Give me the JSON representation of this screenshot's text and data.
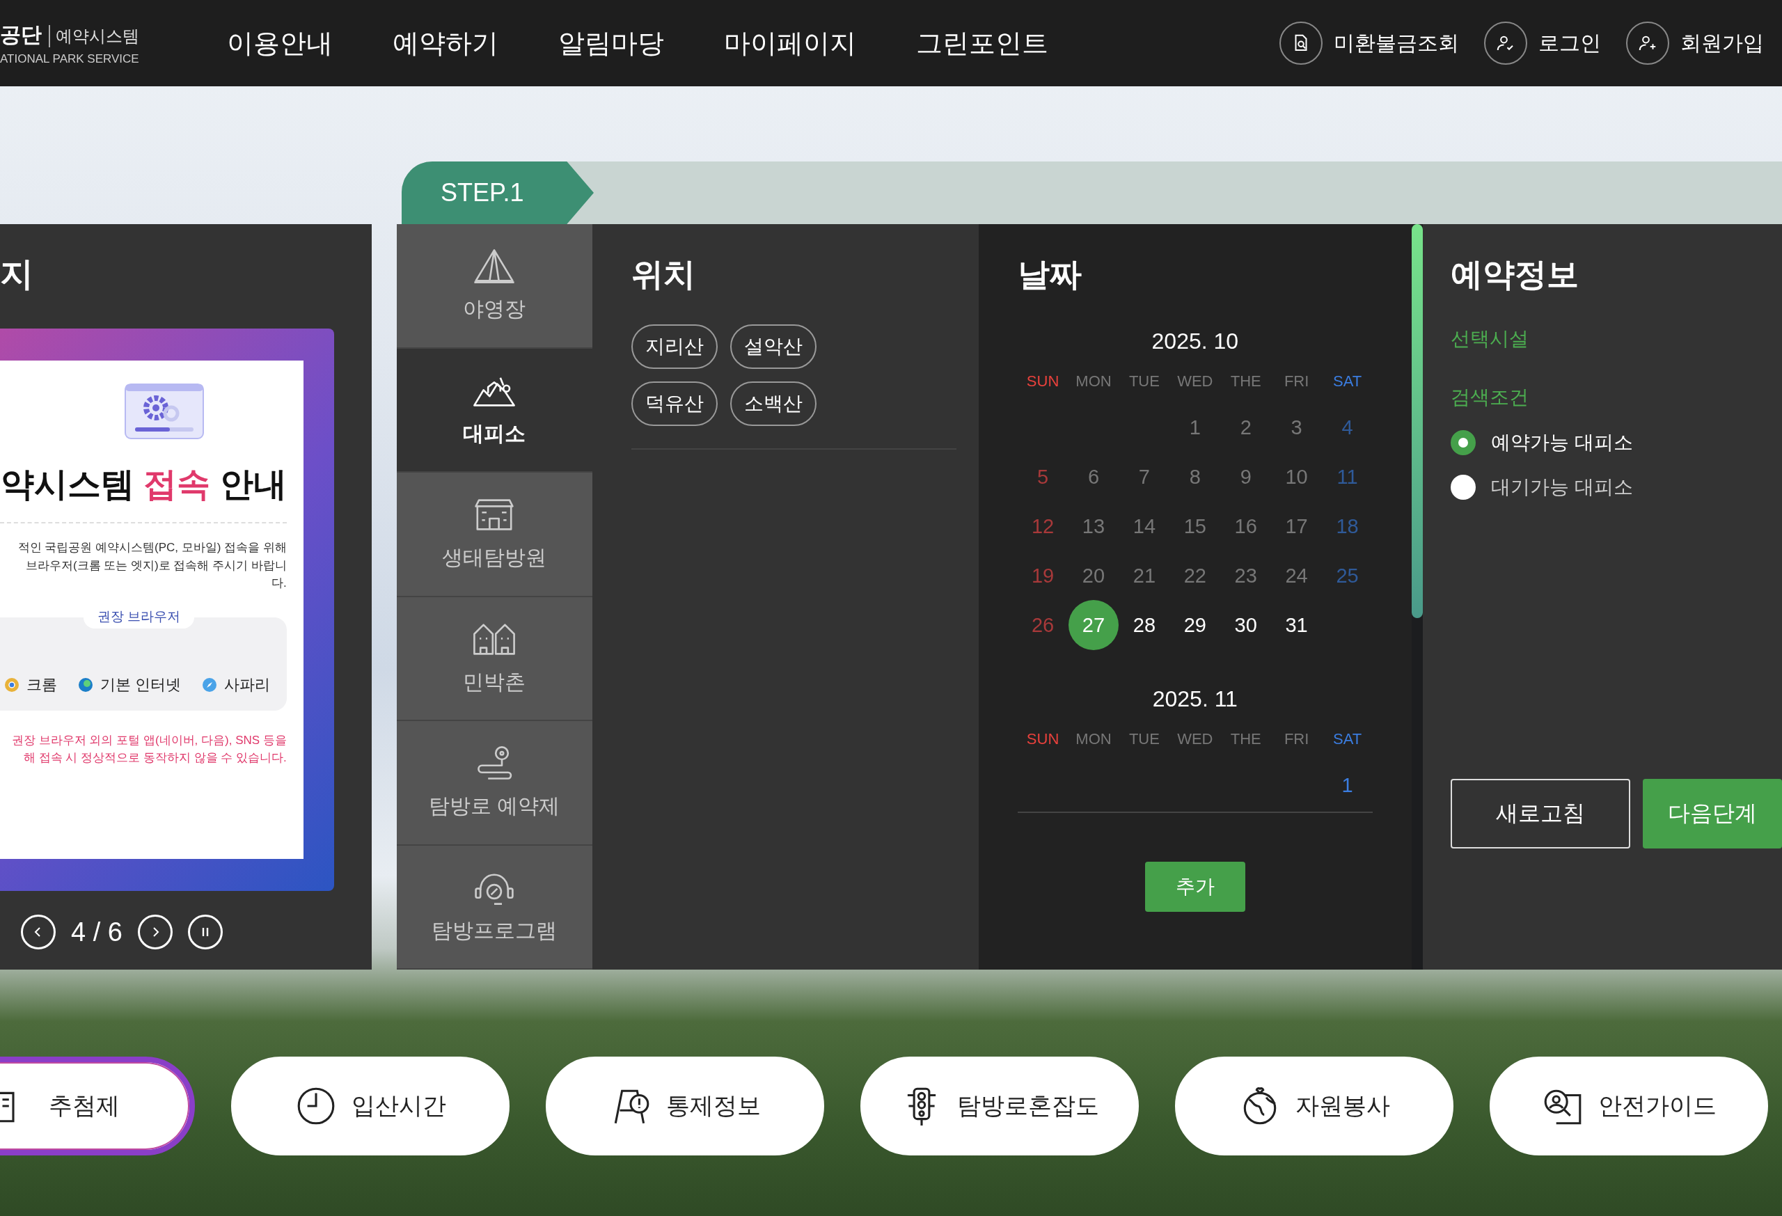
{
  "header": {
    "logo": {
      "name": "공단",
      "system": "예약시스템",
      "english": "ATIONAL PARK SERVICE"
    },
    "nav": [
      "이용안내",
      "예약하기",
      "알림마당",
      "마이페이지",
      "그린포인트"
    ],
    "utility": [
      {
        "kind": "refund",
        "label": "미환불금조회"
      },
      {
        "kind": "login",
        "label": "로그인"
      },
      {
        "kind": "signup",
        "label": "회원가입"
      }
    ]
  },
  "step": {
    "label": "STEP.1"
  },
  "notice": {
    "title": "지",
    "banner": {
      "title": [
        {
          "text": "약시스템 ",
          "highlight": false
        },
        {
          "text": "접속",
          "highlight": true
        },
        {
          "text": " 안내",
          "highlight": false
        }
      ],
      "body": [
        "적인 국립공원 예약시스템(PC, 모바일) 접속을 위해",
        "브라우저(크롬 또는 엣지)로  접속해 주시기 바랍니다."
      ],
      "browsers_label": "권장 브라우저",
      "browsers": [
        {
          "kind": "chrome",
          "label": "크롬"
        },
        {
          "kind": "edge",
          "label": "기본 인터넷"
        },
        {
          "kind": "safari",
          "label": "사파리"
        }
      ],
      "warning": [
        "권장 브라우저 외의 포털 앱(네이버, 다음), SNS 등을",
        "해 접속 시 정상적으로 동작하지 않을 수 있습니다."
      ]
    },
    "pager": "4 / 6"
  },
  "facility_types": [
    {
      "kind": "tent",
      "label": "야영장",
      "selected": false
    },
    {
      "kind": "shelter",
      "label": "대피소",
      "selected": true
    },
    {
      "kind": "eco",
      "label": "생태탐방원",
      "selected": false
    },
    {
      "kind": "village",
      "label": "민박촌",
      "selected": false
    },
    {
      "kind": "trail",
      "label": "탐방로 예약제",
      "selected": false
    },
    {
      "kind": "program",
      "label": "탐방프로그램",
      "selected": false
    }
  ],
  "location": {
    "title": "위치",
    "chips": [
      "지리산",
      "설악산",
      "덕유산",
      "소백산"
    ]
  },
  "date": {
    "title": "날짜",
    "add_button": "추가",
    "months": [
      {
        "title": "2025. 10",
        "weekdays": [
          "SUN",
          "MON",
          "TUE",
          "WED",
          "THE",
          "FRI",
          "SAT"
        ],
        "weeks": [
          [
            {
              "day": "1",
              "available": false,
              "selected": false
            },
            {
              "day": "2",
              "available": false,
              "selected": false
            },
            {
              "day": "3",
              "available": false,
              "selected": false
            },
            {
              "day": "4",
              "available": false,
              "selected": false
            }
          ],
          [
            {
              "day": "5",
              "available": false,
              "selected": false
            },
            {
              "day": "6",
              "available": false,
              "selected": false
            },
            {
              "day": "7",
              "available": false,
              "selected": false
            },
            {
              "day": "8",
              "available": false,
              "selected": false
            },
            {
              "day": "9",
              "available": false,
              "selected": false
            },
            {
              "day": "10",
              "available": false,
              "selected": false
            },
            {
              "day": "11",
              "available": false,
              "selected": false
            }
          ],
          [
            {
              "day": "12",
              "available": false,
              "selected": false
            },
            {
              "day": "13",
              "available": false,
              "selected": false
            },
            {
              "day": "14",
              "available": false,
              "selected": false
            },
            {
              "day": "15",
              "available": false,
              "selected": false
            },
            {
              "day": "16",
              "available": false,
              "selected": false
            },
            {
              "day": "17",
              "available": false,
              "selected": false
            },
            {
              "day": "18",
              "available": false,
              "selected": false
            }
          ],
          [
            {
              "day": "19",
              "available": false,
              "selected": false
            },
            {
              "day": "20",
              "available": false,
              "selected": false
            },
            {
              "day": "21",
              "available": false,
              "selected": false
            },
            {
              "day": "22",
              "available": false,
              "selected": false
            },
            {
              "day": "23",
              "available": false,
              "selected": false
            },
            {
              "day": "24",
              "available": false,
              "selected": false
            },
            {
              "day": "25",
              "available": false,
              "selected": false
            }
          ],
          [
            {
              "day": "26",
              "available": false,
              "selected": false
            },
            {
              "day": "27",
              "available": true,
              "selected": true
            },
            {
              "day": "28",
              "available": true,
              "selected": false
            },
            {
              "day": "29",
              "available": true,
              "selected": false
            },
            {
              "day": "30",
              "available": true,
              "selected": false
            },
            {
              "day": "31",
              "available": true,
              "selected": false
            }
          ]
        ]
      },
      {
        "title": "2025. 11",
        "weekdays": [
          "SUN",
          "MON",
          "TUE",
          "WED",
          "THE",
          "FRI",
          "SAT"
        ],
        "weeks": [
          [
            {
              "day": "1",
              "available": true,
              "selected": false
            }
          ]
        ]
      }
    ]
  },
  "reservation": {
    "title": "예약정보",
    "selected_facility_label": "선택시설",
    "search_label": "검색조건",
    "options": [
      {
        "label": "예약가능 대피소",
        "selected": true
      },
      {
        "label": "대기가능 대피소",
        "selected": false
      }
    ],
    "buttons": [
      {
        "kind": "outline",
        "label": "새로고침"
      },
      {
        "kind": "primary",
        "label": "다음단계"
      }
    ]
  },
  "quick_links": [
    {
      "kind": "lottery",
      "label": "추첨제",
      "selected": true
    },
    {
      "kind": "clock",
      "label": "입산시간",
      "selected": false
    },
    {
      "kind": "control",
      "label": "통제정보",
      "selected": false
    },
    {
      "kind": "traffic",
      "label": "탐방로혼잡도",
      "selected": false
    },
    {
      "kind": "volunteer",
      "label": "자원봉사",
      "selected": false
    },
    {
      "kind": "safety",
      "label": "안전가이드",
      "selected": false
    }
  ]
}
